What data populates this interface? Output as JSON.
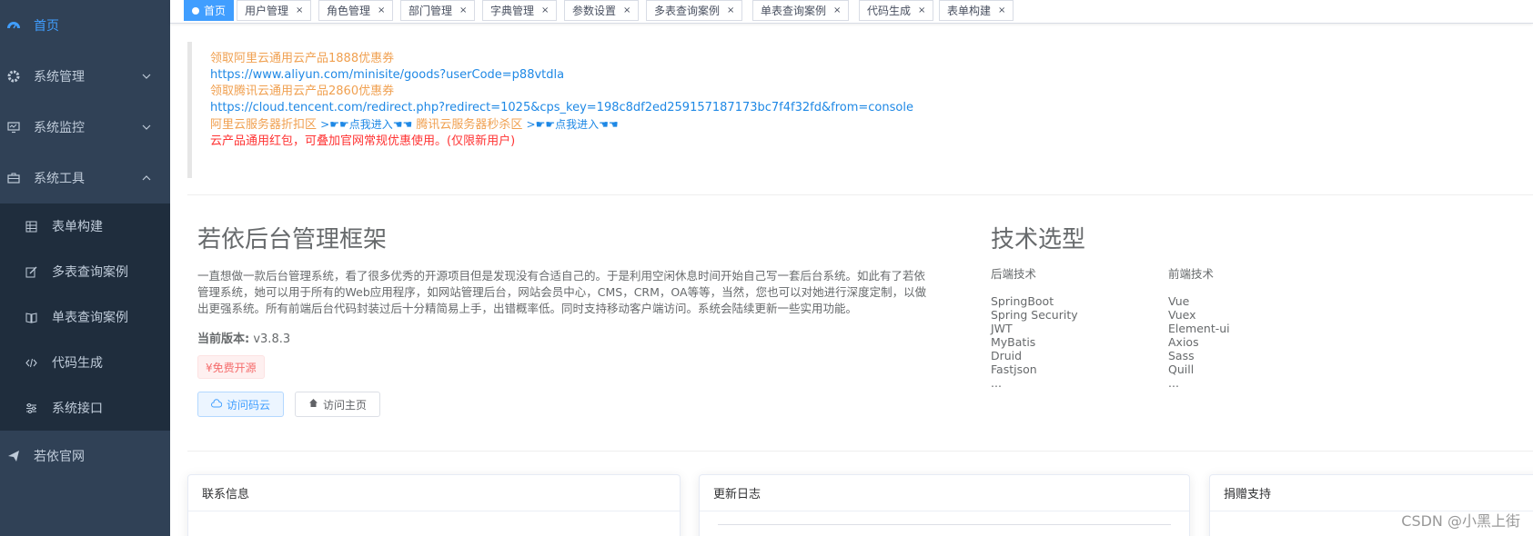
{
  "sidebar": {
    "home": "首页",
    "system_mgmt": "系统管理",
    "system_monitor": "系统监控",
    "system_tools": "系统工具",
    "sub_items": [
      "表单构建",
      "多表查询案例",
      "单表查询案例",
      "代码生成",
      "系统接口"
    ],
    "official_site": "若依官网"
  },
  "tabs": [
    "首页",
    "用户管理",
    "角色管理",
    "部门管理",
    "字典管理",
    "参数设置",
    "多表查询案例",
    "单表查询案例",
    "代码生成",
    "表单构建"
  ],
  "tab_close": "×",
  "promo": {
    "line1": "领取阿里云通用云产品1888优惠券",
    "line2": "https://www.aliyun.com/minisite/goods?userCode=p88vtdla",
    "line3": "领取腾讯云通用云产品2860优惠券",
    "line4": "https://cloud.tencent.com/redirect.php?redirect=1025&cps_key=198c8df2ed259157187173bc7f4f32fd&from=console",
    "aliyun_discount": "阿里云服务器折扣区",
    "click_enter_1": ">☛☛点我进入☚☚",
    "tencent_flash": "腾讯云服务器秒杀区",
    "click_enter_2": ">☛☛点我进入☚☚",
    "notice": "云产品通用红包，可叠加官网常规优惠使用。(仅限新用户)"
  },
  "intro": {
    "title": "若依后台管理框架",
    "description": "一直想做一款后台管理系统，看了很多优秀的开源项目但是发现没有合适自己的。于是利用空闲休息时间开始自己写一套后台系统。如此有了若依管理系统，她可以用于所有的Web应用程序，如网站管理后台，网站会员中心，CMS，CRM，OA等等，当然，您也可以对她进行深度定制，以做出更强系统。所有前端后台代码封装过后十分精简易上手，出错概率低。同时支持移动客户端访问。系统会陆续更新一些实用功能。",
    "version_label": "当前版本:",
    "version_value": "v3.8.3",
    "badge": "¥免费开源",
    "btn_gitee": "访问码云",
    "btn_home": "访问主页"
  },
  "tech": {
    "title": "技术选型",
    "backend_head": "后端技术",
    "backend": [
      "SpringBoot",
      "Spring Security",
      "JWT",
      "MyBatis",
      "Druid",
      "Fastjson",
      "..."
    ],
    "frontend_head": "前端技术",
    "frontend": [
      "Vue",
      "Vuex",
      "Element-ui",
      "Axios",
      "Sass",
      "Quill",
      "..."
    ]
  },
  "cards": {
    "contact": "联系信息",
    "changelog": "更新日志",
    "donate": "捐赠支持"
  },
  "watermark": "CSDN @小黑上街",
  "colors": {
    "sidebar_bg": "#304156",
    "submenu_bg": "#1f2d3d",
    "accent": "#409eff"
  }
}
